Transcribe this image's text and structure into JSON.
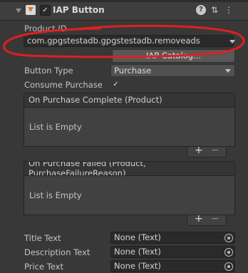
{
  "header": {
    "title": "IAP Button",
    "enabled_check": "✓",
    "help_icon": "?",
    "presets_icon": "⇅",
    "menu_icon": "⋮"
  },
  "product_id": {
    "label": "Product ID",
    "value": "com.gpgstestadb.gpgstestadb.removeads"
  },
  "iap_catalog_button": "IAP Catalog...",
  "button_type": {
    "label": "Button Type",
    "value": "Purchase"
  },
  "consume_purchase": {
    "label": "Consume Purchase",
    "checked": "✓"
  },
  "on_purchase_complete": {
    "header": "On Purchase Complete (Product)",
    "empty_text": "List is Empty",
    "add": "+",
    "remove": "−"
  },
  "on_purchase_failed": {
    "header_line1": "On Purchase Failed (Product,",
    "header_line2": "PurchaseFailureReason)",
    "empty_text": "List is Empty",
    "add": "+",
    "remove": "−"
  },
  "fields": [
    {
      "label": "Title Text",
      "value": "None (Text)"
    },
    {
      "label": "Description Text",
      "value": "None (Text)"
    },
    {
      "label": "Price Text",
      "value": "None (Text)"
    }
  ],
  "colors": {
    "annotation_red": "#e01f1f",
    "background": "#383838"
  }
}
